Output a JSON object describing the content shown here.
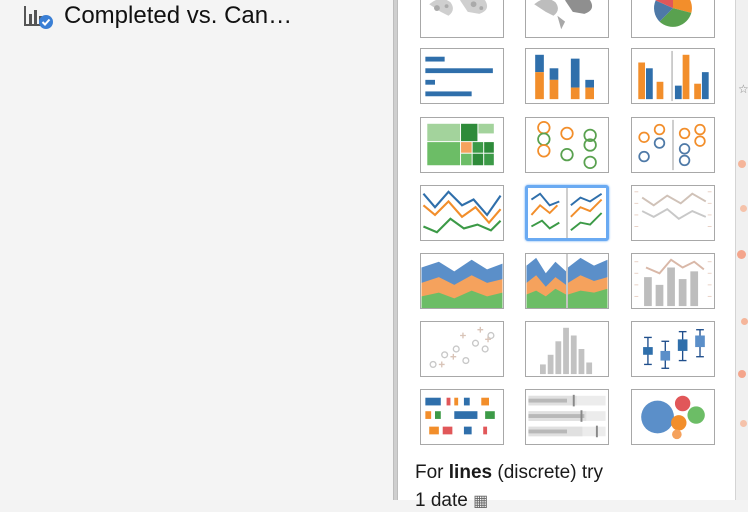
{
  "sheet": {
    "title": "Completed vs. Can…",
    "icon": "bar-chart-check-icon"
  },
  "show_me": {
    "thumbnails": [
      {
        "name": "symbol-map",
        "enabled": false
      },
      {
        "name": "filled-map",
        "enabled": false
      },
      {
        "name": "pie-chart",
        "enabled": true
      },
      {
        "name": "horizontal-bars",
        "enabled": true
      },
      {
        "name": "stacked-bars",
        "enabled": true
      },
      {
        "name": "side-by-side-bars",
        "enabled": true
      },
      {
        "name": "treemap",
        "enabled": true
      },
      {
        "name": "circle-views",
        "enabled": true
      },
      {
        "name": "side-by-side-circles",
        "enabled": true
      },
      {
        "name": "lines-continuous",
        "enabled": true
      },
      {
        "name": "lines-discrete",
        "enabled": true,
        "selected": true
      },
      {
        "name": "dual-lines",
        "enabled": false
      },
      {
        "name": "area-continuous",
        "enabled": true
      },
      {
        "name": "area-discrete",
        "enabled": true
      },
      {
        "name": "dual-combination",
        "enabled": false
      },
      {
        "name": "scatter-plot",
        "enabled": false
      },
      {
        "name": "histogram",
        "enabled": false
      },
      {
        "name": "box-and-whisker",
        "enabled": true
      },
      {
        "name": "gantt-chart",
        "enabled": true
      },
      {
        "name": "bullet-graph",
        "enabled": false
      },
      {
        "name": "packed-bubbles",
        "enabled": true
      }
    ],
    "hint_prefix": "For ",
    "hint_bold": "lines",
    "hint_suffix": " (discrete) try",
    "hint_line2": "1 date"
  },
  "colors": {
    "blue": "#4e79a7",
    "orange": "#f28e2b",
    "green": "#59a14f",
    "red": "#e15759",
    "selection": "#6aaaf2"
  }
}
